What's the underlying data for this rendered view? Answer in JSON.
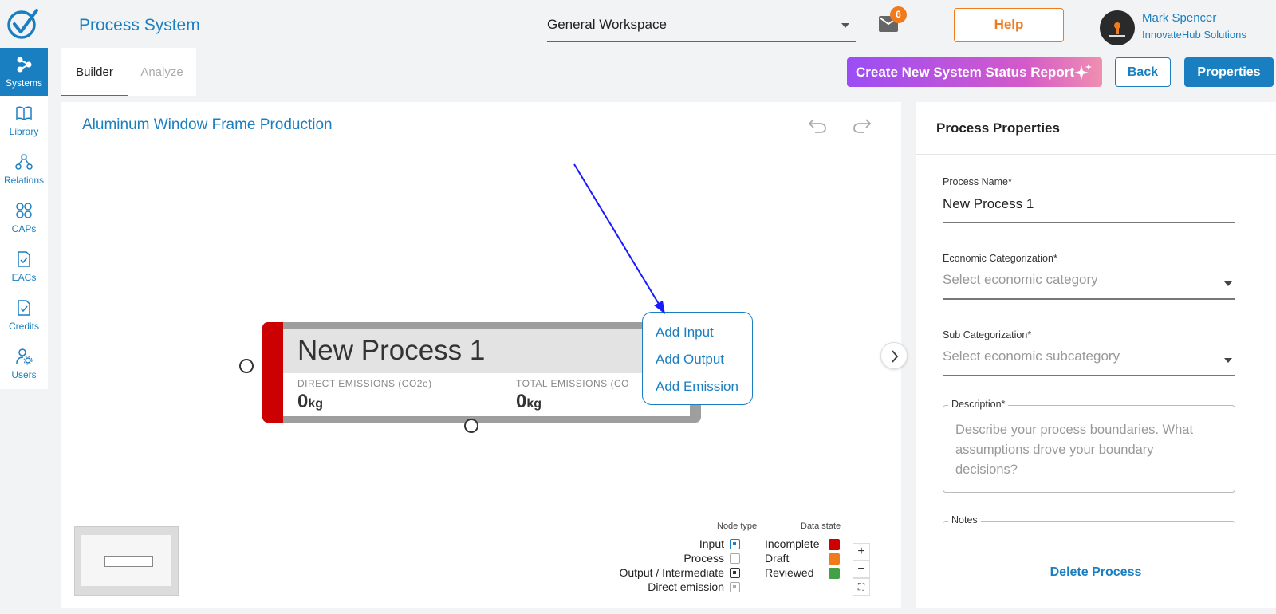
{
  "header": {
    "app_title": "Process System",
    "workspace": "General Workspace",
    "mail_count": "6",
    "help_label": "Help",
    "user_name": "Mark Spencer",
    "user_org": "InnovateHub Solutions"
  },
  "sidebar": {
    "items": [
      {
        "label": "Systems",
        "icon": "systems-icon",
        "active": true
      },
      {
        "label": "Library",
        "icon": "book-icon"
      },
      {
        "label": "Relations",
        "icon": "relations-icon"
      },
      {
        "label": "CAPs",
        "icon": "grid-icon"
      },
      {
        "label": "EACs",
        "icon": "file-check-icon"
      },
      {
        "label": "Credits",
        "icon": "file-check-icon"
      },
      {
        "label": "Users",
        "icon": "users-settings-icon"
      }
    ]
  },
  "tabs": [
    {
      "label": "Builder",
      "active": true
    },
    {
      "label": "Analyze",
      "active": false
    }
  ],
  "toolbar": {
    "report_label": "Create New System Status Report",
    "back_label": "Back",
    "properties_label": "Properties"
  },
  "canvas": {
    "system_title": "Aluminum Window Frame Production",
    "node": {
      "name": "New Process 1",
      "direct_label": "DIRECT EMISSIONS (CO2e)",
      "direct_value": "0",
      "direct_unit": "kg",
      "total_label": "TOTAL EMISSIONS (CO",
      "total_value": "0",
      "total_unit": "kg",
      "state_color": "#cc0000"
    },
    "context_menu": [
      "Add Input",
      "Add Output",
      "Add Emission"
    ],
    "legend": {
      "node_type_title": "Node type",
      "data_state_title": "Data state",
      "node_types": [
        "Input",
        "Process",
        "Output / Intermediate",
        "Direct emission"
      ],
      "data_states": [
        {
          "label": "Incomplete",
          "color": "#cc0000"
        },
        {
          "label": "Draft",
          "color": "#f07b1c"
        },
        {
          "label": "Reviewed",
          "color": "#43a047"
        }
      ]
    },
    "zoom": [
      "+",
      "−",
      "⛶"
    ]
  },
  "panel": {
    "title": "Process Properties",
    "process_name_label": "Process Name",
    "process_name_value": "New Process 1",
    "econ_label": "Economic Categorization",
    "econ_placeholder": "Select economic category",
    "sub_label": "Sub Categorization",
    "sub_placeholder": "Select economic subcategory",
    "desc_label": "Description",
    "desc_placeholder": "Describe your process boundaries. What assumptions drove your boundary decisions?",
    "notes_label": "Notes",
    "required_mark": "*",
    "delete_label": "Delete Process"
  },
  "colors": {
    "accent": "#1a7fc1",
    "help_orange": "#f07b1c"
  }
}
